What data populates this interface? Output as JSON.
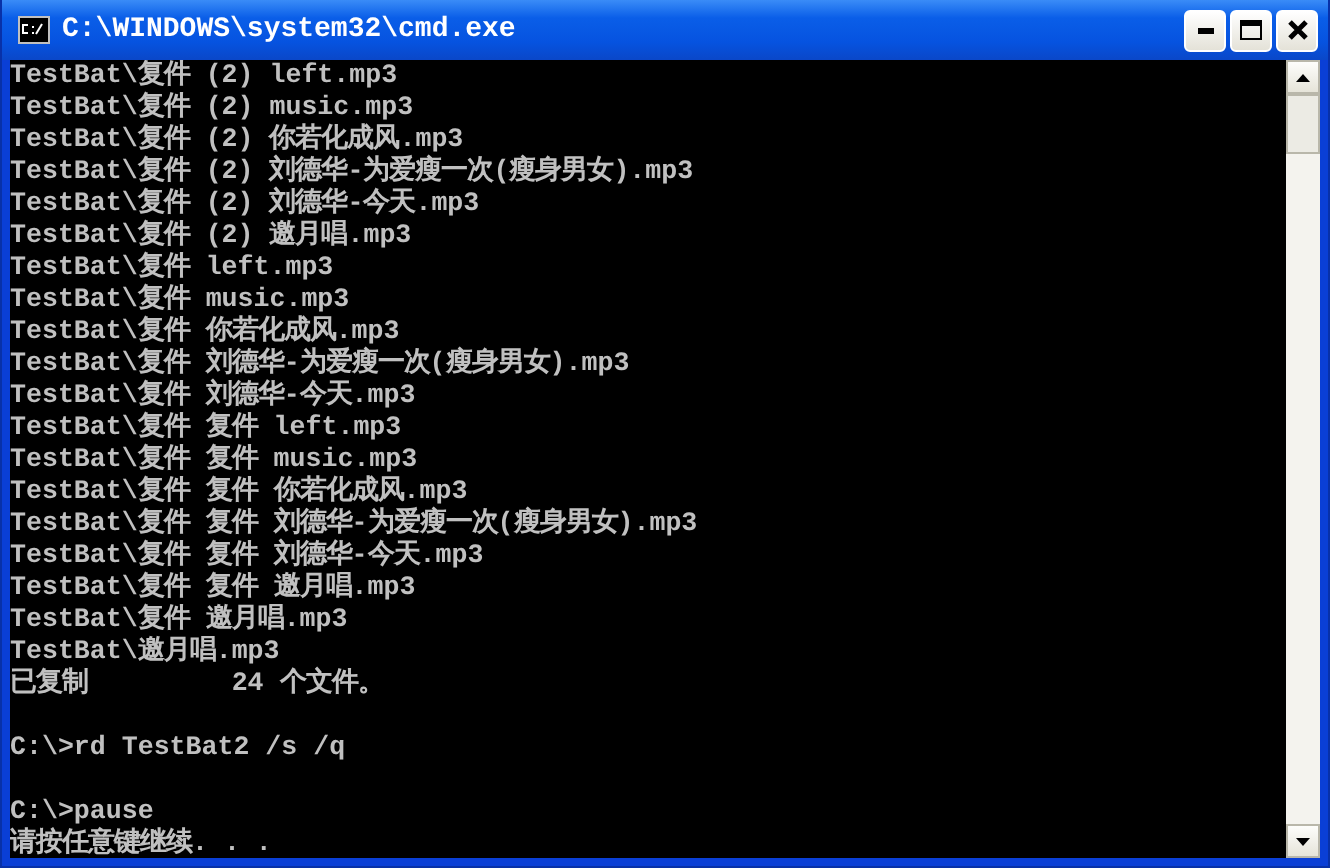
{
  "window": {
    "title": "C:\\WINDOWS\\system32\\cmd.exe"
  },
  "console": {
    "blocks": [
      [
        "TestBat\\复件 (2) left.mp3",
        "TestBat\\复件 (2) music.mp3",
        "TestBat\\复件 (2) 你若化成风.mp3",
        "TestBat\\复件 (2) 刘德华-为爱瘦一次(瘦身男女).mp3",
        "TestBat\\复件 (2) 刘德华-今天.mp3",
        "TestBat\\复件 (2) 邀月唱.mp3",
        "TestBat\\复件 left.mp3",
        "TestBat\\复件 music.mp3",
        "TestBat\\复件 你若化成风.mp3",
        "TestBat\\复件 刘德华-为爱瘦一次(瘦身男女).mp3",
        "TestBat\\复件 刘德华-今天.mp3",
        "TestBat\\复件 复件 left.mp3",
        "TestBat\\复件 复件 music.mp3",
        "TestBat\\复件 复件 你若化成风.mp3",
        "TestBat\\复件 复件 刘德华-为爱瘦一次(瘦身男女).mp3",
        "TestBat\\复件 复件 刘德华-今天.mp3",
        "TestBat\\复件 复件 邀月唱.mp3",
        "TestBat\\复件 邀月唱.mp3",
        "TestBat\\邀月唱.mp3",
        "已复制         24 个文件。"
      ],
      [
        "C:\\>rd TestBat2 /s /q"
      ],
      [
        "C:\\>pause",
        "请按任意键继续. . ."
      ]
    ]
  }
}
